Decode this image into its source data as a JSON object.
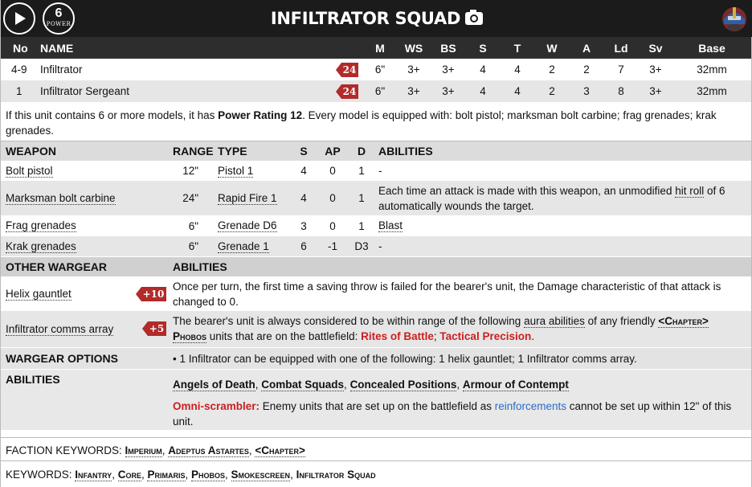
{
  "header": {
    "title": "INFILTRATOR SQUAD",
    "power_value": "6",
    "power_label": "POWER"
  },
  "profile": {
    "headers": [
      "No",
      "NAME",
      "M",
      "WS",
      "BS",
      "S",
      "T",
      "W",
      "A",
      "Ld",
      "Sv",
      "Base"
    ],
    "rows": [
      {
        "no": "4-9",
        "name": "Infiltrator",
        "points": "24",
        "m": "6\"",
        "ws": "3+",
        "bs": "3+",
        "s": "4",
        "t": "4",
        "w": "2",
        "a": "2",
        "ld": "7",
        "sv": "3+",
        "base": "32mm"
      },
      {
        "no": "1",
        "name": "Infiltrator Sergeant",
        "points": "24",
        "m": "6\"",
        "ws": "3+",
        "bs": "3+",
        "s": "4",
        "t": "4",
        "w": "2",
        "a": "3",
        "ld": "8",
        "sv": "3+",
        "base": "32mm"
      }
    ]
  },
  "note": {
    "prefix": "If this unit contains 6 or more models, it has ",
    "bold": "Power Rating 12",
    "suffix": ". Every model is equipped with: bolt pistol; marksman bolt carbine; frag grenades; krak",
    "line2": "grenades."
  },
  "weapons": {
    "headers": [
      "WEAPON",
      "RANGE",
      "TYPE",
      "S",
      "AP",
      "D",
      "ABILITIES"
    ],
    "rows": [
      {
        "name": "Bolt pistol",
        "range": "12\"",
        "type": "Pistol 1",
        "s": "4",
        "ap": "0",
        "d": "1",
        "abilities": "-"
      },
      {
        "name": "Marksman bolt carbine",
        "range": "24\"",
        "type": "Rapid Fire 1",
        "s": "4",
        "ap": "0",
        "d": "1",
        "ab1": "Each time an attack is made with this weapon, an unmodified ",
        "ab_link": "hit roll",
        "ab2": " of 6",
        "ab3": "automatically wounds the target."
      },
      {
        "name": "Frag grenades",
        "range": "6\"",
        "type": "Grenade D6",
        "s": "3",
        "ap": "0",
        "d": "1",
        "abilities": "Blast"
      },
      {
        "name": "Krak grenades",
        "range": "6\"",
        "type": "Grenade 1",
        "s": "6",
        "ap": "-1",
        "d": "D3",
        "abilities": "-"
      }
    ]
  },
  "wargear": {
    "header": "OTHER WARGEAR",
    "abilities_header": "ABILITIES",
    "items": [
      {
        "name": "Helix gauntlet",
        "points": "+10",
        "line1": "Once per turn, the first time a saving throw is failed for the bearer's unit, the Damage characteristic of that attack is",
        "line2": "changed to 0."
      },
      {
        "name": "Infiltrator comms array",
        "points": "+5",
        "line1a": "The bearer's unit is always considered to be within range of the following ",
        "line1_link": "aura abilities",
        "line1b": " of any friendly ",
        "line1_kw": "<Chapter>",
        "line2_kw": "Phobos",
        "line2a": " units that are on the battlefield: ",
        "red1": "Rites of Battle",
        "sep": "; ",
        "red2": "Tactical Precision",
        "end": "."
      }
    ]
  },
  "options": {
    "label": "WARGEAR OPTIONS",
    "text": "• 1 Infiltrator can be equipped with one of the following: 1 helix gauntlet; 1 Infiltrator comms array."
  },
  "abilities": {
    "label": "ABILITIES",
    "list": [
      "Angels of Death",
      "Combat Squads",
      "Concealed Positions",
      "Armour of Contempt"
    ],
    "sep": ", ",
    "omni_name": "Omni-scrambler:",
    "omni_text1": " Enemy units that are set up on the battlefield as ",
    "omni_link": "reinforcements",
    "omni_text2": " cannot be set up within 12\" of this",
    "omni_line2": "unit."
  },
  "faction": {
    "label": "FACTION KEYWORDS: ",
    "k1": "Imperium",
    "k2": "Adeptus Astartes",
    "k3": "<Chapter>",
    "sep": ", "
  },
  "keywords": {
    "label": "KEYWORDS: ",
    "k1": "Infantry",
    "k2": "Core",
    "k3": "Primaris",
    "k4": "Phobos",
    "k5": "Smokescreen",
    "k6": "Infiltrator Squad",
    "sep": ", "
  },
  "colors": {
    "header_bg": "#1b1b1b",
    "points_badge": "#b22a2a",
    "ability_red": "#cc1f1f",
    "link_blue": "#2b6cc4"
  },
  "icons": [
    "play-icon",
    "power-badge",
    "camera-icon",
    "helmet-icon"
  ]
}
